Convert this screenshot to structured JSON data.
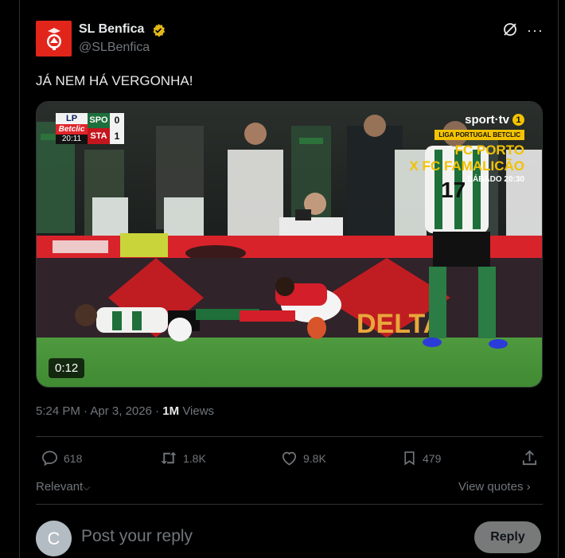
{
  "author": {
    "display_name": "SL Benfica",
    "handle": "@SLBenfica",
    "avatar_icon": "benfica-crest-icon"
  },
  "tweet": {
    "text": "JÁ NEM HÁ VERGONHA!",
    "time": "5:24 PM",
    "date": "Apr 3, 2026",
    "separator": "·",
    "views_count": "1M",
    "views_label": "Views"
  },
  "media": {
    "duration": "0:12",
    "scoreboard": {
      "league_logo": "LP",
      "sponsor": "Betclic",
      "clock": "20:11",
      "home_team": "SPO",
      "home_score": "0",
      "away_team": "STA",
      "away_score": "1"
    },
    "broadcast": {
      "channel": "sport·tv",
      "channel_number": "1",
      "league_banner": "LIGA PORTUGAL BETCLIC",
      "promo_team_1": "FC PORTO",
      "promo_team_2": "X FC FAMALICÃO",
      "promo_time": "SÁBADO 20:30"
    },
    "board_text": "DELTA",
    "shirt_number": "17"
  },
  "actions": {
    "replies": "618",
    "reposts": "1.8K",
    "likes": "9.8K",
    "bookmarks": "479"
  },
  "filters": {
    "sort_label": "Relevant",
    "quotes_label": "View quotes"
  },
  "reply": {
    "avatar_letter": "C",
    "placeholder": "Post your reply",
    "button_label": "Reply"
  },
  "colors": {
    "background": "#000000",
    "benfica_red": "#e1251b",
    "verified_gold": "#e2b719",
    "muted_text": "#71767b"
  }
}
